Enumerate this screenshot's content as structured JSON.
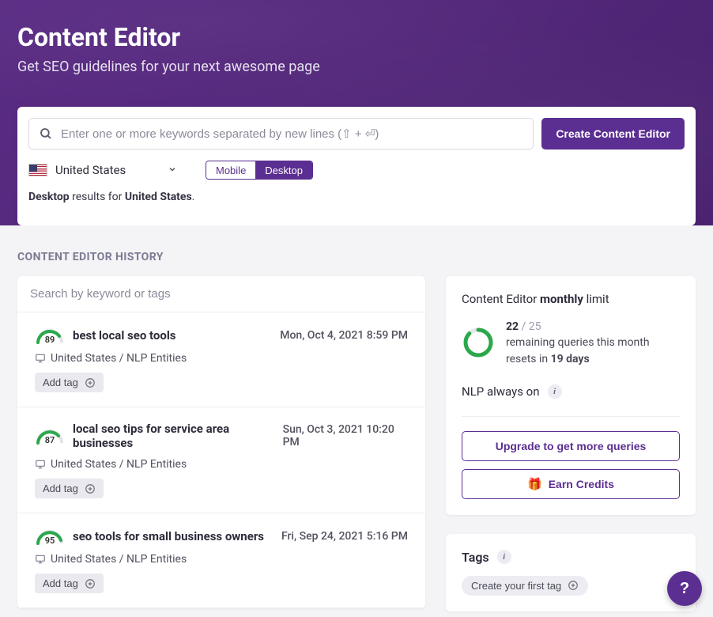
{
  "hero": {
    "title": "Content Editor",
    "subtitle": "Get SEO guidelines for your next awesome page"
  },
  "search": {
    "placeholder": "Enter one or more keywords separated by new lines (⇧ + ⏎)",
    "create_label": "Create Content Editor"
  },
  "country": {
    "name": "United States"
  },
  "device": {
    "mobile": "Mobile",
    "desktop": "Desktop"
  },
  "results_line": {
    "prefix": "Desktop",
    "mid": " results for ",
    "country": "United States",
    "suffix": "."
  },
  "section_history_label": "CONTENT EDITOR HISTORY",
  "history_search_placeholder": "Search by keyword or tags",
  "history": [
    {
      "score": "89",
      "title": "best local seo tools",
      "date": "Mon, Oct 4, 2021 8:59 PM",
      "meta": "United States / NLP Entities",
      "add_tag": "Add tag"
    },
    {
      "score": "87",
      "title": "local seo tips for service area businesses",
      "date": "Sun, Oct 3, 2021 10:20 PM",
      "meta": "United States / NLP Entities",
      "add_tag": "Add tag"
    },
    {
      "score": "95",
      "title": "seo tools for small business owners",
      "date": "Fri, Sep 24, 2021 5:16 PM",
      "meta": "United States / NLP Entities",
      "add_tag": "Add tag"
    }
  ],
  "limit": {
    "title_prefix": "Content Editor ",
    "title_bold": "monthly",
    "title_suffix": " limit",
    "remaining": "22",
    "total": " / 25",
    "line2": "remaining queries this month",
    "line3_prefix": "resets in ",
    "line3_bold": "19 days"
  },
  "nlp_label": "NLP always on",
  "upgrade_label": "Upgrade to get more queries",
  "earn_label": "Earn Credits",
  "tags": {
    "header": "Tags",
    "create_label": "Create your first tag"
  },
  "help": "?"
}
